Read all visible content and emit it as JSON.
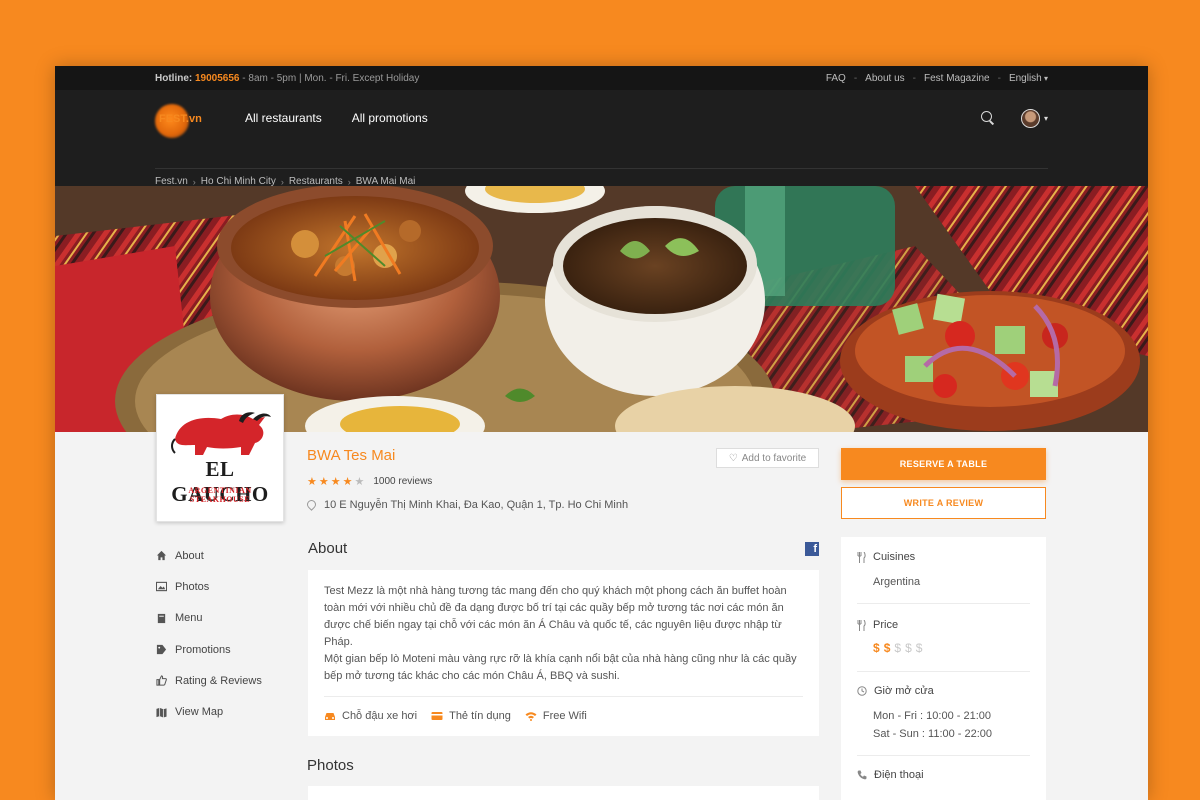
{
  "topbar": {
    "hotline_label": "Hotline:",
    "hotline_number": "19005656",
    "hotline_hours": " - 8am - 5pm | Mon. - Fri. Except Holiday",
    "links": [
      "FAQ",
      "About us",
      "Fest Magazine"
    ],
    "language": "English"
  },
  "nav": {
    "logo_text": "FEST",
    "logo_suffix": ".vn",
    "links": [
      "All restaurants",
      "All promotions"
    ]
  },
  "breadcrumb": [
    "Fest.vn",
    "Ho Chi Minh City",
    "Restaurants",
    "BWA Mai Mai"
  ],
  "restaurant": {
    "name": "BWA Tes Mai",
    "rating": 4,
    "rating_max": 5,
    "reviews": "1000 reviews",
    "address": "10 E Nguyễn Thị Minh Khai, Đa Kao, Quận 1, Tp. Ho Chi Minh",
    "logo_title": "EL GAUCHO",
    "logo_subtitle": "ARGENTINIAN STEAKHOUSE",
    "favorite_label": "Add to favorite"
  },
  "actions": {
    "reserve": "RESERVE A TABLE",
    "review": "WRITE A REVIEW"
  },
  "sidemenu": [
    {
      "label": "About",
      "icon": "home-icon"
    },
    {
      "label": "Photos",
      "icon": "image-icon"
    },
    {
      "label": "Menu",
      "icon": "book-icon"
    },
    {
      "label": "Promotions",
      "icon": "tag-icon"
    },
    {
      "label": "Rating & Reviews",
      "icon": "thumbs-up-icon"
    },
    {
      "label": "View Map",
      "icon": "map-icon"
    }
  ],
  "about": {
    "heading": "About",
    "text": "Test Mezz là một nhà hàng tương tác mang đến cho quý khách một phong cách ăn buffet hoàn toàn mới với nhiều chủ đề đa dạng được bố trí tại các quầy bếp mở tương tác nơi các món ăn được chế biến ngay tại chỗ với các món ăn Á Châu và quốc tế, các nguyên liệu được nhập từ Pháp.",
    "text2": "Một gian bếp lò Moteni màu vàng rực rỡ là khía cạnh nổi bật của nhà hàng cũng như là các quầy bếp mở tương tác khác cho các món Châu Á, BBQ và sushi.",
    "amenities": [
      "Chỗ đậu xe hơi",
      "Thẻ tín dụng",
      "Free Wifi"
    ]
  },
  "photos": {
    "heading": "Photos"
  },
  "info": {
    "cuisines_label": "Cuisines",
    "cuisines_value": "Argentina",
    "price_label": "Price",
    "price_level": 2,
    "price_max": 5,
    "hours_label": "Giờ mở cửa",
    "hours": [
      "Mon - Fri : 10:00 - 21:00",
      "Sat - Sun : 11:00 - 22:00"
    ],
    "phone_label": "Điện thoại"
  },
  "colors": {
    "accent": "#f7891f",
    "dark": "#1e1e1e",
    "background": "#f7891f"
  }
}
